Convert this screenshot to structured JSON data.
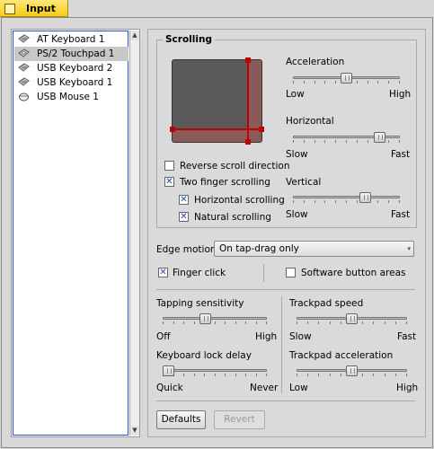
{
  "tab": {
    "title": "Input"
  },
  "devices": [
    {
      "label": "AT Keyboard 1",
      "icon": "keyboard-icon",
      "selected": false
    },
    {
      "label": "PS/2 Touchpad 1",
      "icon": "touchpad-icon",
      "selected": true
    },
    {
      "label": "USB Keyboard 2",
      "icon": "keyboard-icon",
      "selected": false
    },
    {
      "label": "USB Keyboard 1",
      "icon": "keyboard-icon",
      "selected": false
    },
    {
      "label": "USB Mouse 1",
      "icon": "mouse-icon",
      "selected": false
    }
  ],
  "scrolling": {
    "title": "Scrolling",
    "acceleration": {
      "label": "Acceleration",
      "min": "Low",
      "max": "High",
      "value": 0.5
    },
    "horizontal": {
      "label": "Horizontal",
      "min": "Slow",
      "max": "Fast",
      "value": 0.85
    },
    "vertical": {
      "label": "Vertical",
      "min": "Slow",
      "max": "Fast",
      "value": 0.7
    },
    "reverse": {
      "label": "Reverse scroll direction",
      "checked": false
    },
    "two_finger": {
      "label": "Two finger scrolling",
      "checked": true
    },
    "two_finger_horizontal": {
      "label": "Horizontal scrolling",
      "checked": true
    },
    "natural": {
      "label": "Natural scrolling",
      "checked": true
    }
  },
  "edge_motion": {
    "label": "Edge motion:",
    "value": "On tap-drag only"
  },
  "finger_click": {
    "label": "Finger click",
    "checked": true
  },
  "software_buttons": {
    "label": "Software button areas",
    "checked": false
  },
  "tapping": {
    "label": "Tapping sensitivity",
    "min": "Off",
    "max": "High",
    "value": 0.4
  },
  "keyboard_lock": {
    "label": "Keyboard lock delay",
    "min": "Quick",
    "max": "Never",
    "value": 0.0
  },
  "trackpad_speed": {
    "label": "Trackpad speed",
    "min": "Slow",
    "max": "Fast",
    "value": 0.5
  },
  "trackpad_accel": {
    "label": "Trackpad acceleration",
    "min": "Low",
    "max": "High",
    "value": 0.5
  },
  "buttons": {
    "defaults": "Defaults",
    "revert": "Revert"
  },
  "colors": {
    "tab_bg": "#f5cb1c",
    "scroll_zone": "#8a5a5a",
    "scroll_line": "#c00000",
    "list_focus": "#2a4bd7"
  }
}
